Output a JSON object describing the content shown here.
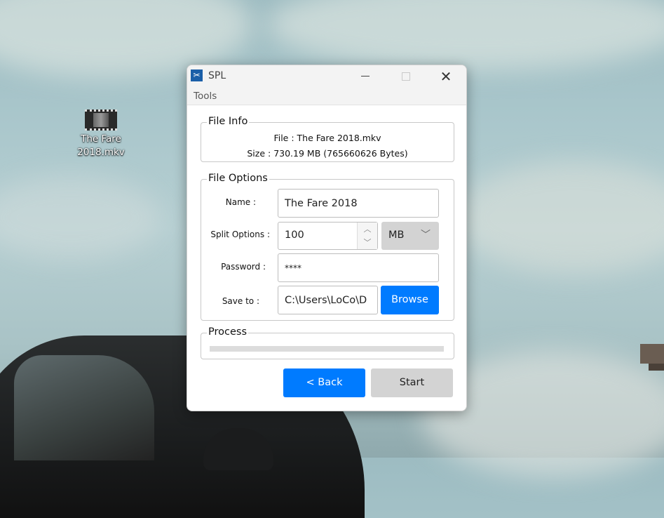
{
  "desktop": {
    "file_icon_name": "video-file-icon",
    "file_label_line1": "The Fare",
    "file_label_line2": "2018.mkv"
  },
  "window": {
    "title": "SPL",
    "icon_glyph": "✂",
    "controls": {
      "minimize": "minimize-icon",
      "maximize": "maximize-icon",
      "close": "✕"
    }
  },
  "menu": {
    "tools": "Tools"
  },
  "file_info": {
    "legend": "File Info",
    "file_line": "File : The Fare 2018.mkv",
    "size_line": "Size : 730.19 MB (765660626 Bytes)"
  },
  "file_options": {
    "legend": "File Options",
    "name_label": "Name :",
    "name_value": "The Fare 2018",
    "split_label": "Split Options :",
    "split_value": "100",
    "split_unit": "MB",
    "spin_up": "︿",
    "spin_down": "﹀",
    "select_arrow": "﹀",
    "password_label": "Password :",
    "password_value": "****",
    "save_label": "Save to :",
    "save_value": "C:\\Users\\LoCo\\D",
    "browse_label": "Browse"
  },
  "process": {
    "legend": "Process",
    "progress_fraction": 0
  },
  "actions": {
    "back_label": "< Back",
    "start_label": "Start"
  },
  "colors": {
    "accent": "#007bff",
    "button_gray": "#d3d3d3"
  }
}
